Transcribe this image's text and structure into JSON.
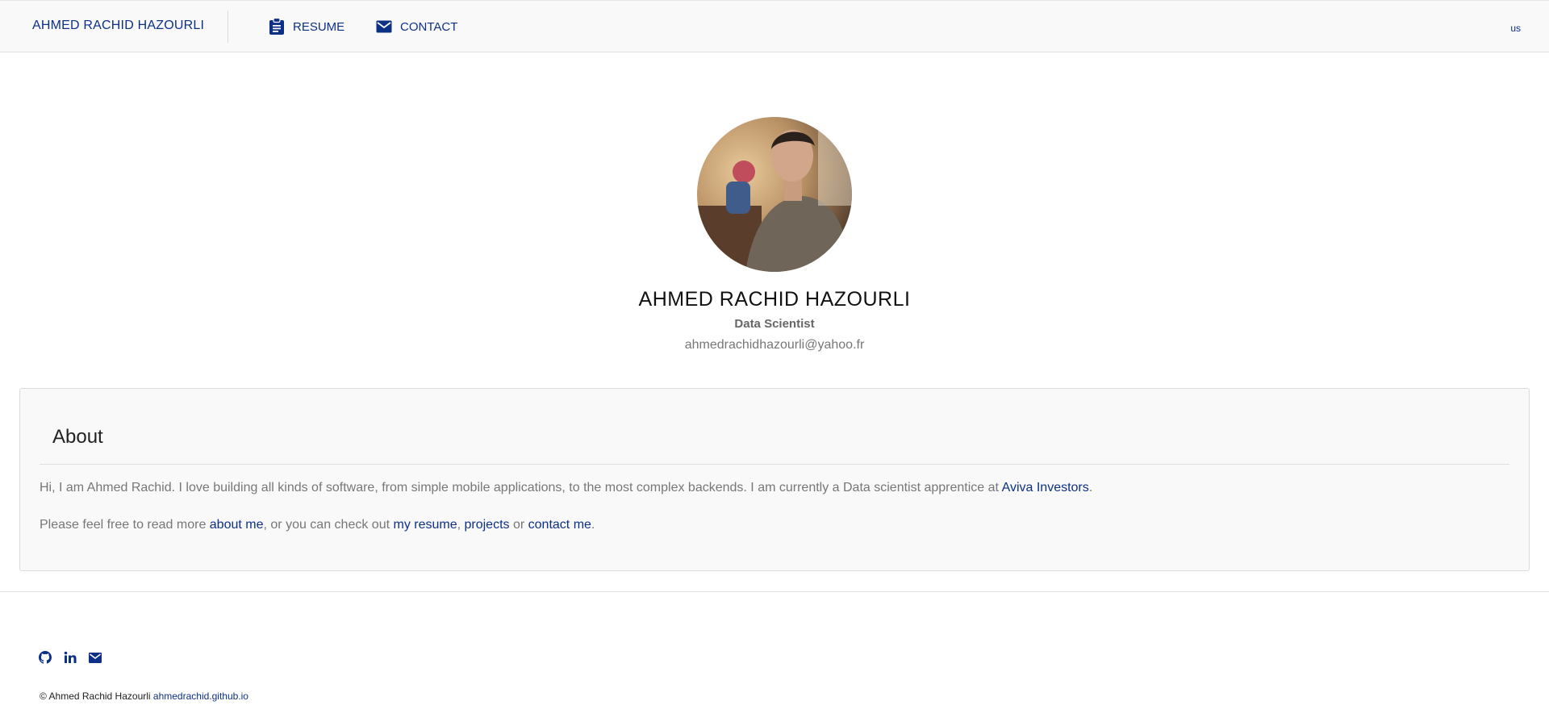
{
  "nav": {
    "brand": "AHMED RACHID HAZOURLI",
    "resume_label": "RESUME",
    "contact_label": "CONTACT",
    "lang": "us"
  },
  "profile": {
    "name": "AHMED RACHID HAZOURLI",
    "title": "Data Scientist",
    "email": "ahmedrachidhazourli@yahoo.fr"
  },
  "about": {
    "heading": "About",
    "p1_text": "Hi, I am Ahmed Rachid. I love building all kinds of software, from simple mobile applications, to the most complex backends. I am currently a Data scientist apprentice at ",
    "p1_link": "Aviva Investors",
    "p1_end": ".",
    "p2_start": "Please feel free to read more ",
    "p2_link_about": "about me",
    "p2_mid1": ", or you can check out ",
    "p2_link_resume": "my resume",
    "p2_comma": ", ",
    "p2_link_projects": "projects",
    "p2_or": " or ",
    "p2_link_contact": "contact me",
    "p2_end": "."
  },
  "footer": {
    "copyright": "© Ahmed Rachid Hazourli ",
    "site_link": "ahmedrachid.github.io",
    "social_icons": [
      "github-icon",
      "linkedin-icon",
      "mail-icon"
    ]
  },
  "colors": {
    "accent": "#0d3087",
    "muted_text": "#777777",
    "card_bg": "#f9f9f9"
  }
}
